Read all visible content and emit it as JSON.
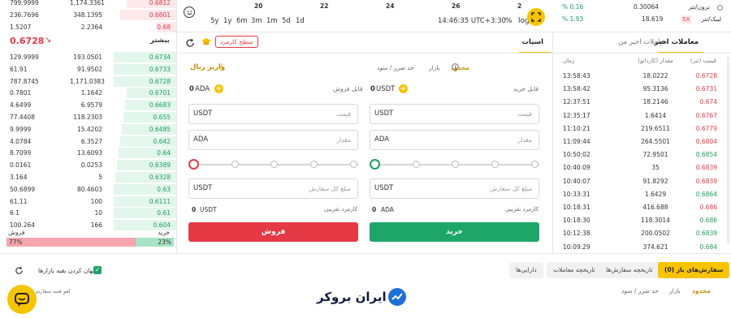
{
  "orderbook": {
    "top_asks": [
      {
        "amount": "799.9999",
        "total": "1,174.3361",
        "price": "0.6812"
      },
      {
        "amount": "236.7696",
        "total": "348.1395",
        "price": "0.6801"
      },
      {
        "amount": "1.5207",
        "total": "2.2364",
        "price": "0.68"
      }
    ],
    "last_price": "0.6728",
    "more_label": "بیشتر",
    "bids": [
      {
        "amount": "129.9999",
        "total": "193.0501",
        "price": "0.6734"
      },
      {
        "amount": "61.91",
        "total": "91.9502",
        "price": "0.6733"
      },
      {
        "amount": "787.8745",
        "total": "1,171.0383",
        "price": "0.6728"
      },
      {
        "amount": "0.7801",
        "total": "1.1642",
        "price": "0.6701"
      },
      {
        "amount": "4.6499",
        "total": "6.9579",
        "price": "0.6683"
      },
      {
        "amount": "77.4408",
        "total": "118.2303",
        "price": "0.655"
      },
      {
        "amount": "9.9999",
        "total": "15.4202",
        "price": "0.6485"
      },
      {
        "amount": "4.0784",
        "total": "6.3527",
        "price": "0.642"
      },
      {
        "amount": "8.7099",
        "total": "13.6093",
        "price": "0.64"
      },
      {
        "amount": "0.0161",
        "total": "0.0253",
        "price": "0.6389"
      },
      {
        "amount": "3.164",
        "total": "5",
        "price": "0.6328"
      },
      {
        "amount": "50.6899",
        "total": "80.4603",
        "price": "0.63"
      },
      {
        "amount": "61.11",
        "total": "100",
        "price": "0.6111"
      },
      {
        "amount": "6.1",
        "total": "10",
        "price": "0.61"
      },
      {
        "amount": "100.264",
        "total": "166",
        "price": "0.604"
      }
    ],
    "sell_label": "فروش",
    "buy_label": "خرید",
    "sell_pct": "77%",
    "buy_pct": "23%",
    "sell_ratio": 0.77,
    "buy_ratio": 0.23
  },
  "chart": {
    "dates": [
      "20",
      "22",
      "24",
      "26",
      "2"
    ],
    "timeframes": [
      "5y",
      "1y",
      "6m",
      "3m",
      "1m",
      "5d",
      "1d"
    ],
    "clock": "14:46:35 UTC+3:30",
    "pct_label": "%",
    "log_label": "log"
  },
  "markets": [
    {
      "name": "ترون/تتر",
      "price": "0.30064",
      "change": "% 0.16",
      "badge": ""
    },
    {
      "name": "لینک/تتر",
      "price": "18.619",
      "change": "% 1.93",
      "badge": "5X"
    }
  ],
  "form": {
    "tab_spot": "اسپات",
    "tab_recent_trades": "معاملات اخیر من",
    "fee_level_label": "سطح کارمزد",
    "deposit_label": "واریز ریال",
    "order_types": [
      "محدود",
      "بازار",
      "حد ضرر / سود"
    ],
    "buy_available_label": "قابل خرید",
    "buy_available_value": "0",
    "buy_available_unit": "USDT",
    "sell_available_label": "قابل فروش",
    "sell_available_value": "0",
    "sell_available_unit": "ADA",
    "price_placeholder": "قیمت",
    "amount_placeholder": "مقدار",
    "total_placeholder": "مبلغ کل سفارش",
    "buy_price_unit": "USDT",
    "buy_amount_unit": "ADA",
    "buy_total_unit": "USDT",
    "sell_price_unit": "USDT",
    "sell_amount_unit": "ADA",
    "sell_total_unit": "USDT",
    "fee_label": "کارمزد تقریبی",
    "buy_fee_value": "0",
    "buy_fee_unit": "ADA",
    "sell_fee_value": "0",
    "sell_fee_unit": "USDT",
    "buy_button": "خرید",
    "sell_button": "فروش"
  },
  "trades": {
    "tab_label": "معاملات اخیر",
    "header_price": "قیمت (تتر)",
    "header_amount": "مقدار (کاردانو)",
    "header_time": "زمان",
    "rows": [
      {
        "time": "13:58:43",
        "amount": "18.0222",
        "price": "0.6728",
        "side": "sell"
      },
      {
        "time": "13:58:42",
        "amount": "95.3136",
        "price": "0.6731",
        "side": "sell"
      },
      {
        "time": "12:37:51",
        "amount": "18.2146",
        "price": "0.674",
        "side": "sell"
      },
      {
        "time": "12:35:17",
        "amount": "1.6414",
        "price": "0.6767",
        "side": "sell"
      },
      {
        "time": "11:10:21",
        "amount": "219.6511",
        "price": "0.6779",
        "side": "sell"
      },
      {
        "time": "11:09:44",
        "amount": "264.5501",
        "price": "0.6804",
        "side": "sell"
      },
      {
        "time": "10:50:02",
        "amount": "72.9501",
        "price": "0.6854",
        "side": "buy"
      },
      {
        "time": "10:40:09",
        "amount": "35",
        "price": "0.6839",
        "side": "sell"
      },
      {
        "time": "10:40:07",
        "amount": "91.8292",
        "price": "0.6839",
        "side": "sell"
      },
      {
        "time": "10:33:31",
        "amount": "1.6429",
        "price": "0.6864",
        "side": "buy"
      },
      {
        "time": "10:18:31",
        "amount": "416.688",
        "price": "0.686",
        "side": "sell"
      },
      {
        "time": "10:18:30",
        "amount": "118.3014",
        "price": "0.686",
        "side": "buy"
      },
      {
        "time": "10:12:38",
        "amount": "200.0502",
        "price": "0.6839",
        "side": "buy"
      },
      {
        "time": "10:09:29",
        "amount": "374.621",
        "price": "0.684",
        "side": "buy"
      }
    ]
  },
  "bottom": {
    "tabs": [
      "سفارش‌های باز (0)",
      "تاریخچه سفارش‌ها",
      "تاریخچه معاملات",
      "دارایی‌ها"
    ],
    "hide_other_markets": "پنهان کردن بقیه بازارها",
    "order_types": [
      "محدود",
      "بازار",
      "حد ضرر / سود"
    ],
    "cancel_all": "لغو همه سفارش‌ها",
    "logo_text": "ایران بروکر"
  },
  "colors": {
    "red": "#e53946",
    "green": "#1a9e5e",
    "yellow": "#f7c400"
  }
}
